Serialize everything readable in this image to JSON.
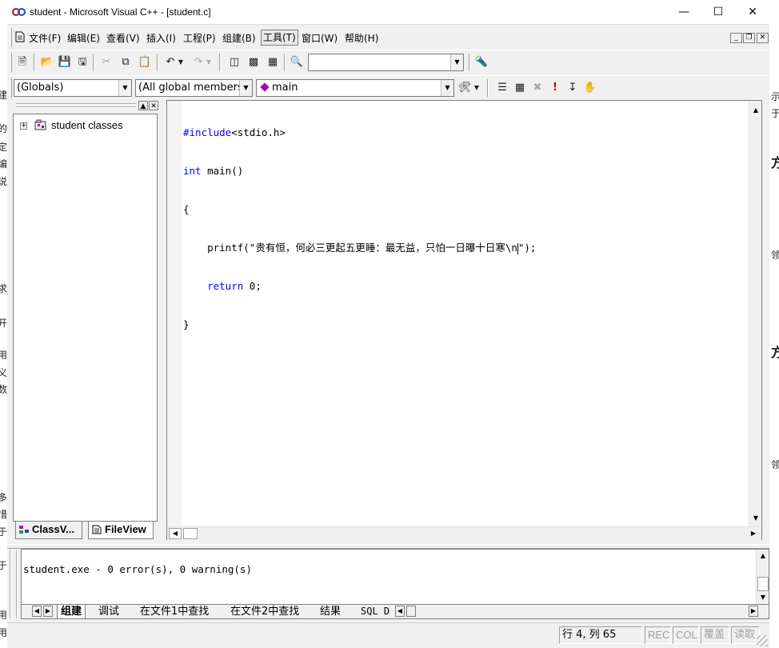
{
  "window": {
    "title": "student - Microsoft Visual C++ - [student.c]"
  },
  "menu": {
    "items": [
      "文件(F)",
      "编辑(E)",
      "查看(V)",
      "插入(I)",
      "工程(P)",
      "组建(B)",
      "工具(T)",
      "窗口(W)",
      "帮助(H)"
    ]
  },
  "toolbar": {
    "find_combo_value": "",
    "globals_combo": "(Globals)",
    "members_combo": "(All global members",
    "function_combo": "main"
  },
  "workspace": {
    "tree_root": "student classes",
    "tabs": [
      "ClassV...",
      "FileView"
    ]
  },
  "editor": {
    "lines": [
      {
        "pre": "",
        "kw": "#include",
        "rest": "<stdio.h>"
      },
      {
        "pre": "",
        "kw": "int",
        "rest": " main()"
      },
      {
        "pre": "",
        "kw": "",
        "rest": "{"
      },
      {
        "pre": "    ",
        "kw": "",
        "rest": "printf(\"贵有恒，何必三更起五更睡：最无益，只怕一日曝十日寒\\n",
        "caret": true,
        "after": "\");"
      },
      {
        "pre": "    ",
        "kw": "return",
        "rest": " 0;"
      },
      {
        "pre": "",
        "kw": "",
        "rest": "}"
      }
    ]
  },
  "output": {
    "text": "student.exe - 0 error(s), 0 warning(s)",
    "tabs": [
      "组建",
      "调试",
      "在文件1中查找",
      "在文件2中查找",
      "结果",
      "SQL D"
    ]
  },
  "status": {
    "position": "行 4, 列 65",
    "rec": "REC",
    "col": "COL",
    "ovr": "覆盖",
    "readonly": "读取"
  },
  "background": {
    "left_glyphs": [
      "建",
      "的",
      "定",
      "编",
      "说",
      "求",
      "开",
      "用",
      "义",
      "数",
      "多",
      "惜",
      "于",
      "于",
      "用",
      "用"
    ],
    "right_glyphs": [
      "示",
      "于",
      "方",
      "领",
      "方",
      "领"
    ]
  }
}
